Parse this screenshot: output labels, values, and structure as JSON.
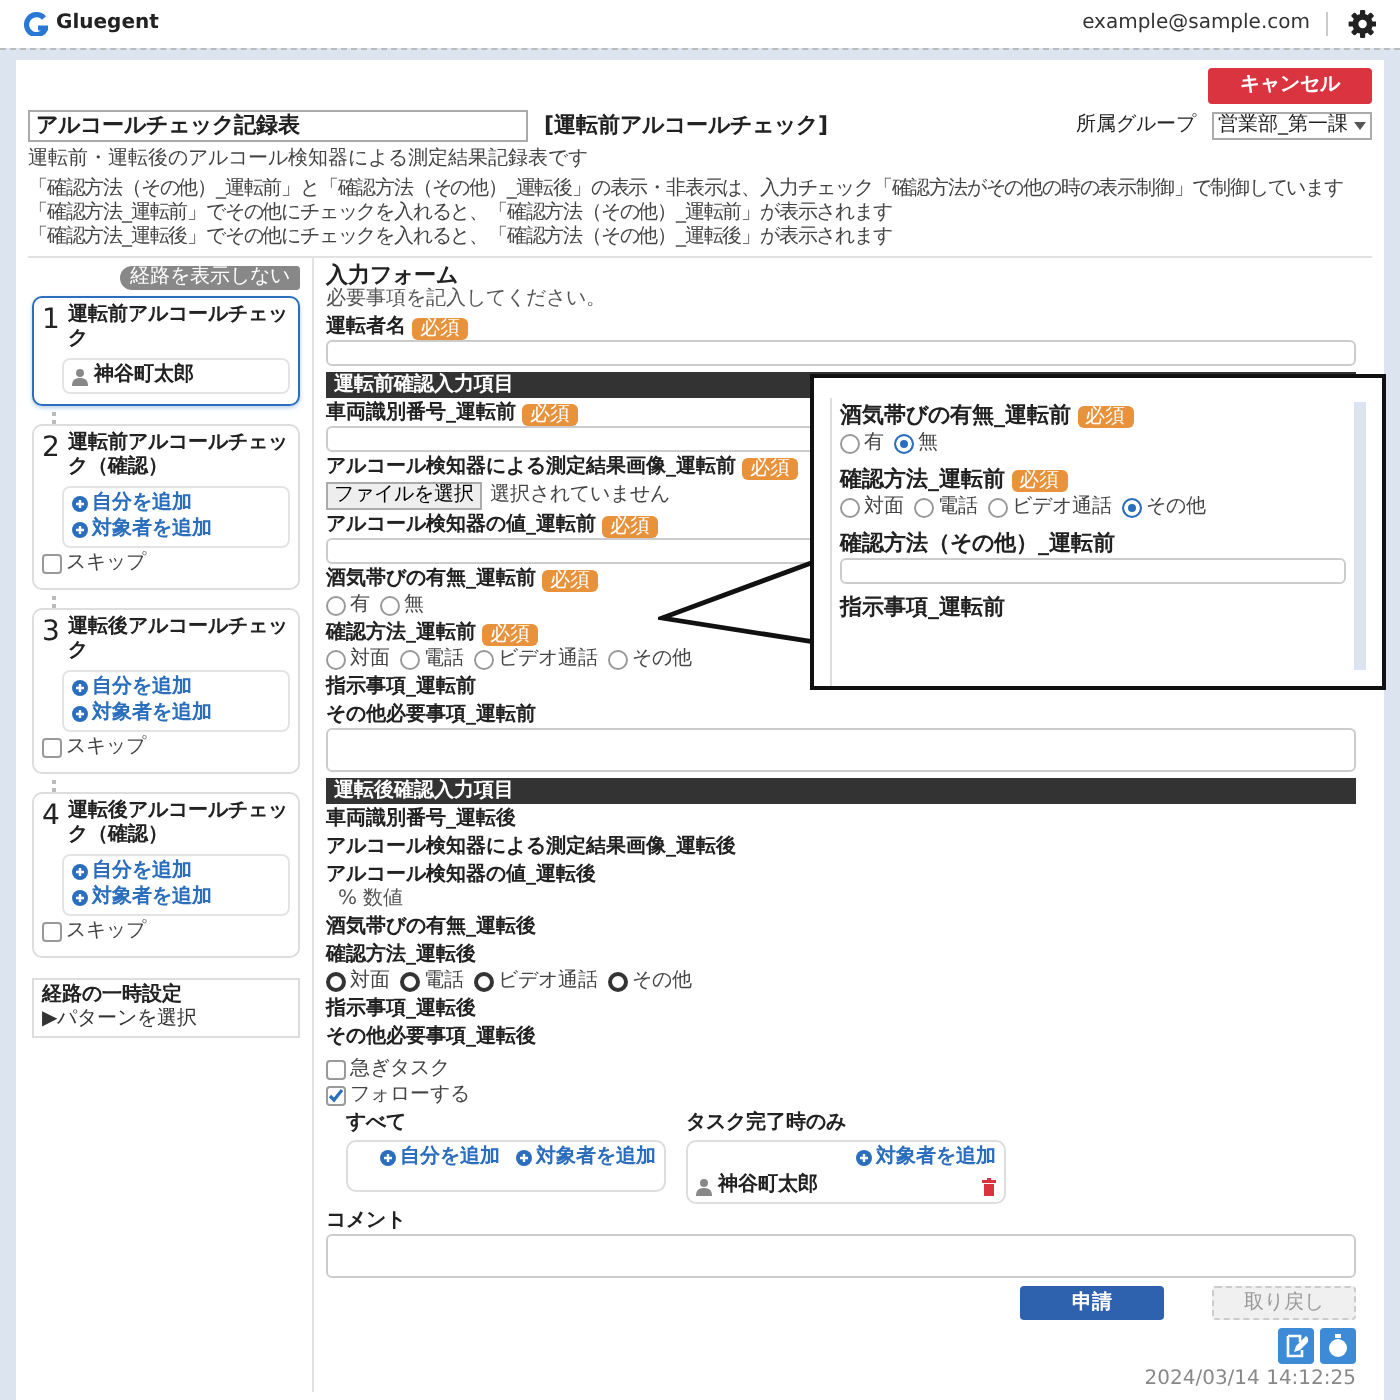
{
  "header": {
    "logo_text": "Gluegent",
    "user_email": "example@sample.com"
  },
  "top": {
    "cancel_button": "キャンセル",
    "title_value": "アルコールチェック記録表",
    "step_name": "[運転前アルコールチェック]",
    "group_label": "所属グループ",
    "group_value": "営業部_第一課",
    "description": "運転前・運転後のアルコール検知器による測定結果記録表です",
    "notes": [
      "「確認方法（その他）_運転前」と「確認方法（その他）_運転後」の表示・非表示は、入力チェック「確認方法がその他の時の表示制御」で制御しています",
      "「確認方法_運転前」でその他にチェックを入れると、「確認方法（その他）_運転前」が表示されます",
      "「確認方法_運転後」でその他にチェックを入れると、「確認方法（その他）_運転後」が表示されます"
    ]
  },
  "route": {
    "toggle_button": "経路を表示しない",
    "steps": [
      {
        "number": "1",
        "title": "運転前アルコールチェック",
        "active": true,
        "users": [
          "神谷町太郎"
        ]
      },
      {
        "number": "2",
        "title": "運転前アルコールチェック（確認）",
        "active": false,
        "buttons": [
          "自分を追加",
          "対象者を追加"
        ],
        "skip": {
          "label": "スキップ",
          "checked": false
        }
      },
      {
        "number": "3",
        "title": "運転後アルコールチェック",
        "active": false,
        "buttons": [
          "自分を追加",
          "対象者を追加"
        ],
        "skip": {
          "label": "スキップ",
          "checked": false
        }
      },
      {
        "number": "4",
        "title": "運転後アルコールチェック（確認）",
        "active": false,
        "buttons": [
          "自分を追加",
          "対象者を追加"
        ],
        "skip": {
          "label": "スキップ",
          "checked": false
        }
      }
    ],
    "temp_setting": {
      "title": "経路の一時設定",
      "link": "▶パターンを選択"
    }
  },
  "form": {
    "title": "入力フォーム",
    "hint": "必要事項を記入してください。",
    "items": [
      {
        "kind": "input",
        "label": "運転者名",
        "badge": "必須"
      },
      {
        "kind": "section",
        "label": "運転前確認入力項目"
      },
      {
        "kind": "input",
        "label": "車両識別番号_運転前",
        "badge": "必須"
      },
      {
        "kind": "file",
        "label": "アルコール検知器による測定結果画像_運転前",
        "badge": "必須",
        "button": "ファイルを選択",
        "status": "選択されていません"
      },
      {
        "kind": "input",
        "label": "アルコール検知器の値_運転前",
        "badge": "必須"
      },
      {
        "kind": "radio",
        "label": "酒気帯びの有無_運転前",
        "badge": "必須",
        "disabled": false,
        "options": [
          {
            "label": "有",
            "selected": false
          },
          {
            "label": "無",
            "selected": false
          }
        ]
      },
      {
        "kind": "radio",
        "label": "確認方法_運転前",
        "badge": "必須",
        "disabled": false,
        "options": [
          {
            "label": "対面",
            "selected": false
          },
          {
            "label": "電話",
            "selected": false
          },
          {
            "label": "ビデオ通話",
            "selected": false
          },
          {
            "label": "その他",
            "selected": false
          }
        ]
      },
      {
        "kind": "text",
        "label": "指示事項_運転前"
      },
      {
        "kind": "textarea",
        "label": "その他必要事項_運転前"
      },
      {
        "kind": "section",
        "label": "運転後確認入力項目"
      },
      {
        "kind": "text",
        "label": "車両識別番号_運転後"
      },
      {
        "kind": "text",
        "label": "アルコール検知器による測定結果画像_運転後"
      },
      {
        "kind": "value",
        "label": "アルコール検知器の値_運転後",
        "value": "% 数値"
      },
      {
        "kind": "text",
        "label": "酒気帯びの有無_運転後"
      },
      {
        "kind": "radio",
        "label": "確認方法_運転後",
        "disabled": true,
        "options": [
          {
            "label": "対面",
            "selected": false
          },
          {
            "label": "電話",
            "selected": false
          },
          {
            "label": "ビデオ通話",
            "selected": false
          },
          {
            "label": "その他",
            "selected": false
          }
        ]
      },
      {
        "kind": "text",
        "label": "指示事項_運転後"
      },
      {
        "kind": "text",
        "label": "その他必要事項_運転後"
      }
    ]
  },
  "options": [
    {
      "label": "急ぎタスク",
      "checked": false
    },
    {
      "label": "フォローする",
      "checked": true
    }
  ],
  "followers": [
    {
      "title": "すべて",
      "buttons": [
        "自分を追加",
        "対象者を追加"
      ]
    },
    {
      "title": "タスク完了時のみ",
      "buttons": [
        "対象者を追加"
      ],
      "users": [
        "神谷町太郎"
      ]
    }
  ],
  "comment": {
    "label": "コメント"
  },
  "actions": [
    {
      "label": "申請",
      "disabled": false
    },
    {
      "label": "取り戻し",
      "disabled": true
    }
  ],
  "timestamp": "2024/03/14 14:12:25",
  "callout": {
    "items": [
      {
        "kind": "radio",
        "label": "酒気帯びの有無_運転前",
        "badge": "必須",
        "disabled": false,
        "options": [
          {
            "label": "有",
            "selected": false
          },
          {
            "label": "無",
            "selected": true
          }
        ]
      },
      {
        "kind": "radio",
        "label": "確認方法_運転前",
        "badge": "必須",
        "disabled": false,
        "options": [
          {
            "label": "対面",
            "selected": false
          },
          {
            "label": "電話",
            "selected": false
          },
          {
            "label": "ビデオ通話",
            "selected": false
          },
          {
            "label": "その他",
            "selected": true
          }
        ]
      },
      {
        "kind": "input",
        "label": "確認方法（その他）_運転前"
      },
      {
        "kind": "text",
        "label": "指示事項_運転前"
      }
    ]
  }
}
